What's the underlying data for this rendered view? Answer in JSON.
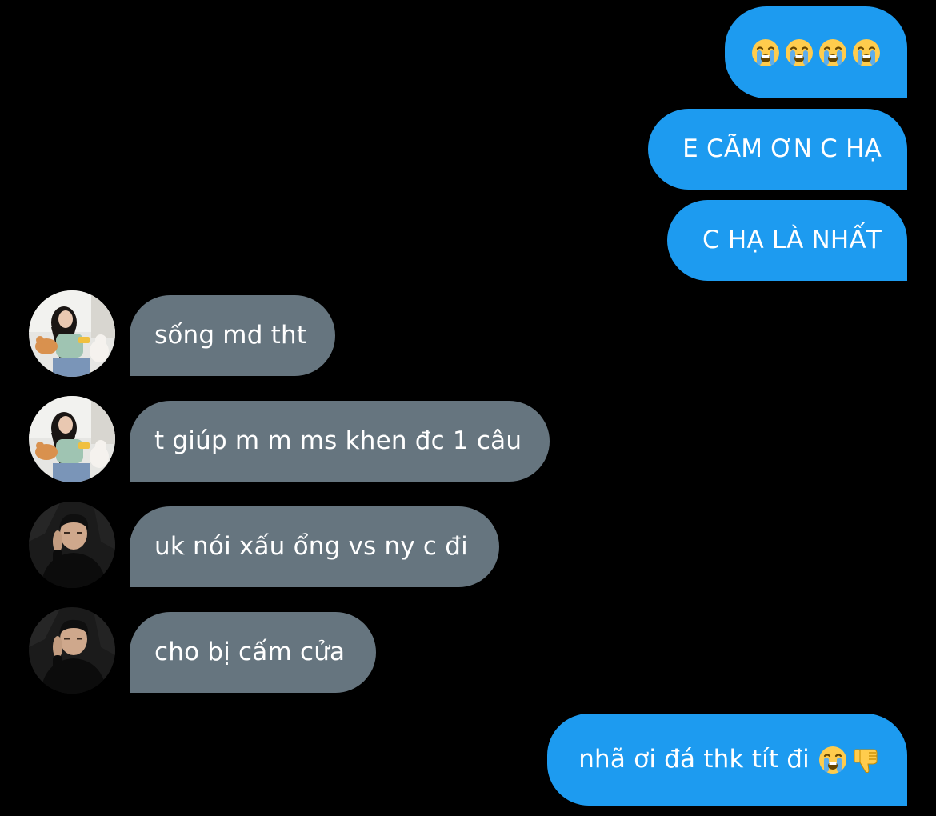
{
  "messages": [
    {
      "side": "outgoing",
      "text": "",
      "emoji": [
        "loudly-crying-face-icon",
        "loudly-crying-face-icon",
        "loudly-crying-face-icon",
        "loudly-crying-face-icon"
      ]
    },
    {
      "side": "outgoing",
      "text": "E CÃM ƠN C HẠ"
    },
    {
      "side": "outgoing",
      "text": "C HẠ LÀ NHẤT"
    },
    {
      "side": "incoming",
      "sender": "girl-with-cats-avatar",
      "text": "sống md tht"
    },
    {
      "side": "incoming",
      "sender": "girl-with-cats-avatar",
      "text": "t giúp m m ms khen đc 1 câu"
    },
    {
      "side": "incoming",
      "sender": "man-in-black-avatar",
      "text": "uk nói xấu ổng vs ny c đi"
    },
    {
      "side": "incoming",
      "sender": "man-in-black-avatar",
      "text": "cho bị cấm cửa"
    },
    {
      "side": "outgoing",
      "text": "nhã ơi đá thk tít đi",
      "emoji": [
        "loudly-crying-face-icon",
        "thumbs-down-icon"
      ]
    }
  ],
  "colors": {
    "background": "#000000",
    "outgoing_bubble": "#1d9bf0",
    "incoming_bubble": "#66757f",
    "text": "#ffffff"
  }
}
